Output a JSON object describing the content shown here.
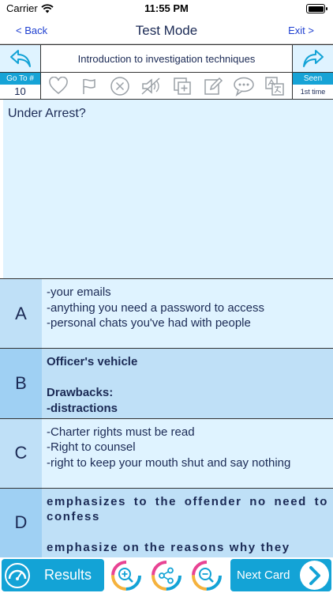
{
  "status": {
    "carrier": "Carrier",
    "time": "11:55 PM"
  },
  "nav": {
    "back": "< Back",
    "title": "Test Mode",
    "exit": "Exit >"
  },
  "topic": "Introduction to investigation techniques",
  "goto": {
    "label": "Go To #",
    "value": "10"
  },
  "seen": {
    "label": "Seen",
    "value": "1st time"
  },
  "tools": [
    "heart-icon",
    "flag-icon",
    "x-circle-icon",
    "mute-icon",
    "copy-plus-icon",
    "edit-icon",
    "speech-icon",
    "translate-icon"
  ],
  "question": "Under Arrest?",
  "options": [
    {
      "letter": "A",
      "text": "-your emails\n-anything you need a password to access\n-personal chats you've had with people"
    },
    {
      "letter": "B",
      "text": "Officer's vehicle\n\nDrawbacks:\n-distractions"
    },
    {
      "letter": "C",
      "text": "-Charter rights must be read\n-Right to counsel\n-right to keep your mouth shut and say nothing"
    },
    {
      "letter": "D",
      "text": "emphasizes to the offender no need to confess\n\nemphasize on the reasons why they"
    }
  ],
  "bottom": {
    "results": "Results",
    "next": "Next Card"
  },
  "colors": {
    "accent": "#13a3d6",
    "panel": "#dff3ff",
    "panel_alt": "#bfe0f7",
    "text": "#1b2a55",
    "link": "#1e3fd0"
  }
}
